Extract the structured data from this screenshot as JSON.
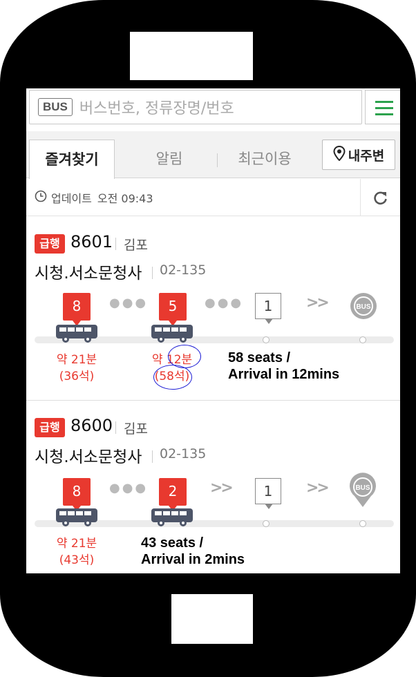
{
  "search": {
    "tag": "BUS",
    "placeholder": "버스번호, 정류장명/번호"
  },
  "tabs": {
    "favorites": "즐겨찾기",
    "alerts": "알림",
    "recent": "최근이용",
    "nearby": "내주변"
  },
  "update": {
    "label": "업데이트",
    "time": "오전 09:43"
  },
  "cards": [
    {
      "badge": "급행",
      "route": "8601",
      "dest": "김포",
      "stop": "시청.서소문청사",
      "stop_id": "02-135",
      "buses": [
        {
          "marker": "8",
          "time": "약 21분",
          "seats": "(36석)"
        },
        {
          "marker": "5",
          "time": "약 12분",
          "seats": "(58석)"
        }
      ],
      "stop_marker": "1",
      "note": [
        "58 seats /",
        "Arrival in 12mins"
      ]
    },
    {
      "badge": "급행",
      "route": "8600",
      "dest": "김포",
      "stop": "시청.서소문청사",
      "stop_id": "02-135",
      "buses": [
        {
          "marker": "8",
          "time": "약 21분",
          "seats": "(43석)"
        },
        {
          "marker": "2"
        }
      ],
      "stop_marker": "1",
      "note": [
        "43 seats /",
        "Arrival in 2mins"
      ]
    }
  ],
  "icons": {
    "bus_stop": "BUS"
  },
  "colors": {
    "accent_red": "#e8392f",
    "menu_green": "#2ca24d",
    "annotation_blue": "#1c1cd4"
  }
}
